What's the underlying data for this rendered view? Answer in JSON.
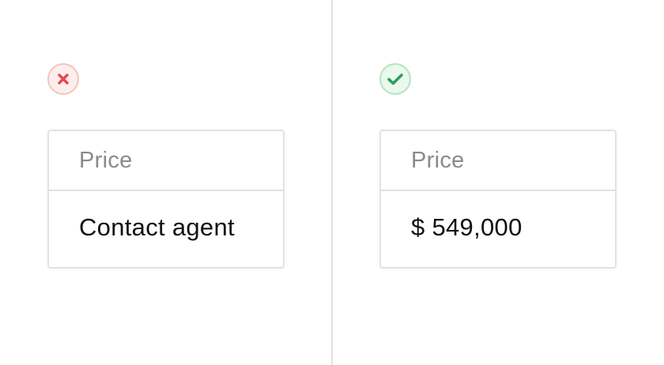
{
  "colors": {
    "bad_accent": "#e5484d",
    "good_accent": "#2e9e5b",
    "border": "#e2e2e2",
    "label_text": "#8a8a8a",
    "value_text": "#111111"
  },
  "bad_example": {
    "status_icon": "close-icon",
    "label": "Price",
    "value": "Contact agent"
  },
  "good_example": {
    "status_icon": "check-icon",
    "label": "Price",
    "value": "$ 549,000"
  }
}
